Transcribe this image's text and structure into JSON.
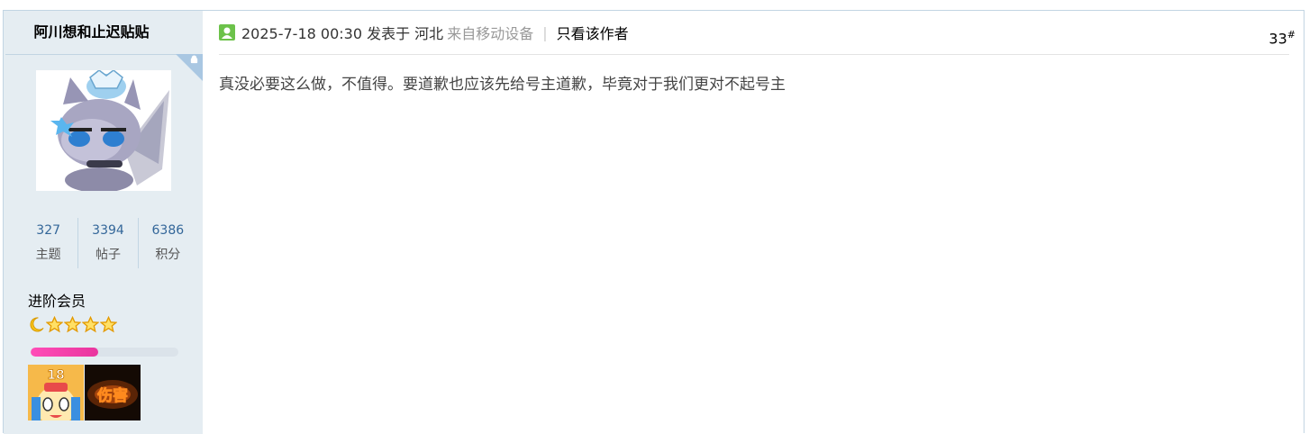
{
  "post": {
    "author": "阿川想和止迟贴贴",
    "stats": [
      {
        "value": "327",
        "label": "主题"
      },
      {
        "value": "3394",
        "label": "帖子"
      },
      {
        "value": "6386",
        "label": "积分"
      }
    ],
    "rank_title": "进阶会员",
    "progress_fraction": 0.46,
    "medal_2_text": "伤害",
    "medal_1_text": "18",
    "header": {
      "datetime": "2025-7-18 00:30 发表于 河北",
      "source": "来自移动设备",
      "separator": "|",
      "only_author": "只看该作者",
      "floor": "33",
      "floor_mark": "#"
    },
    "content": "真没必要这么做，不值得。要道歉也应该先给号主道歉，毕竟对于我们更对不起号主"
  },
  "icons": {
    "device": "android-icon",
    "online": "user-online-icon",
    "rank_level": [
      "moon-icon",
      "star-icon",
      "star-icon",
      "star-icon",
      "star-icon"
    ]
  },
  "colors": {
    "sidebar_bg": "#e5edf2",
    "stat_value": "#336699",
    "progress": "#e9359e",
    "star": "#f5c21b"
  }
}
